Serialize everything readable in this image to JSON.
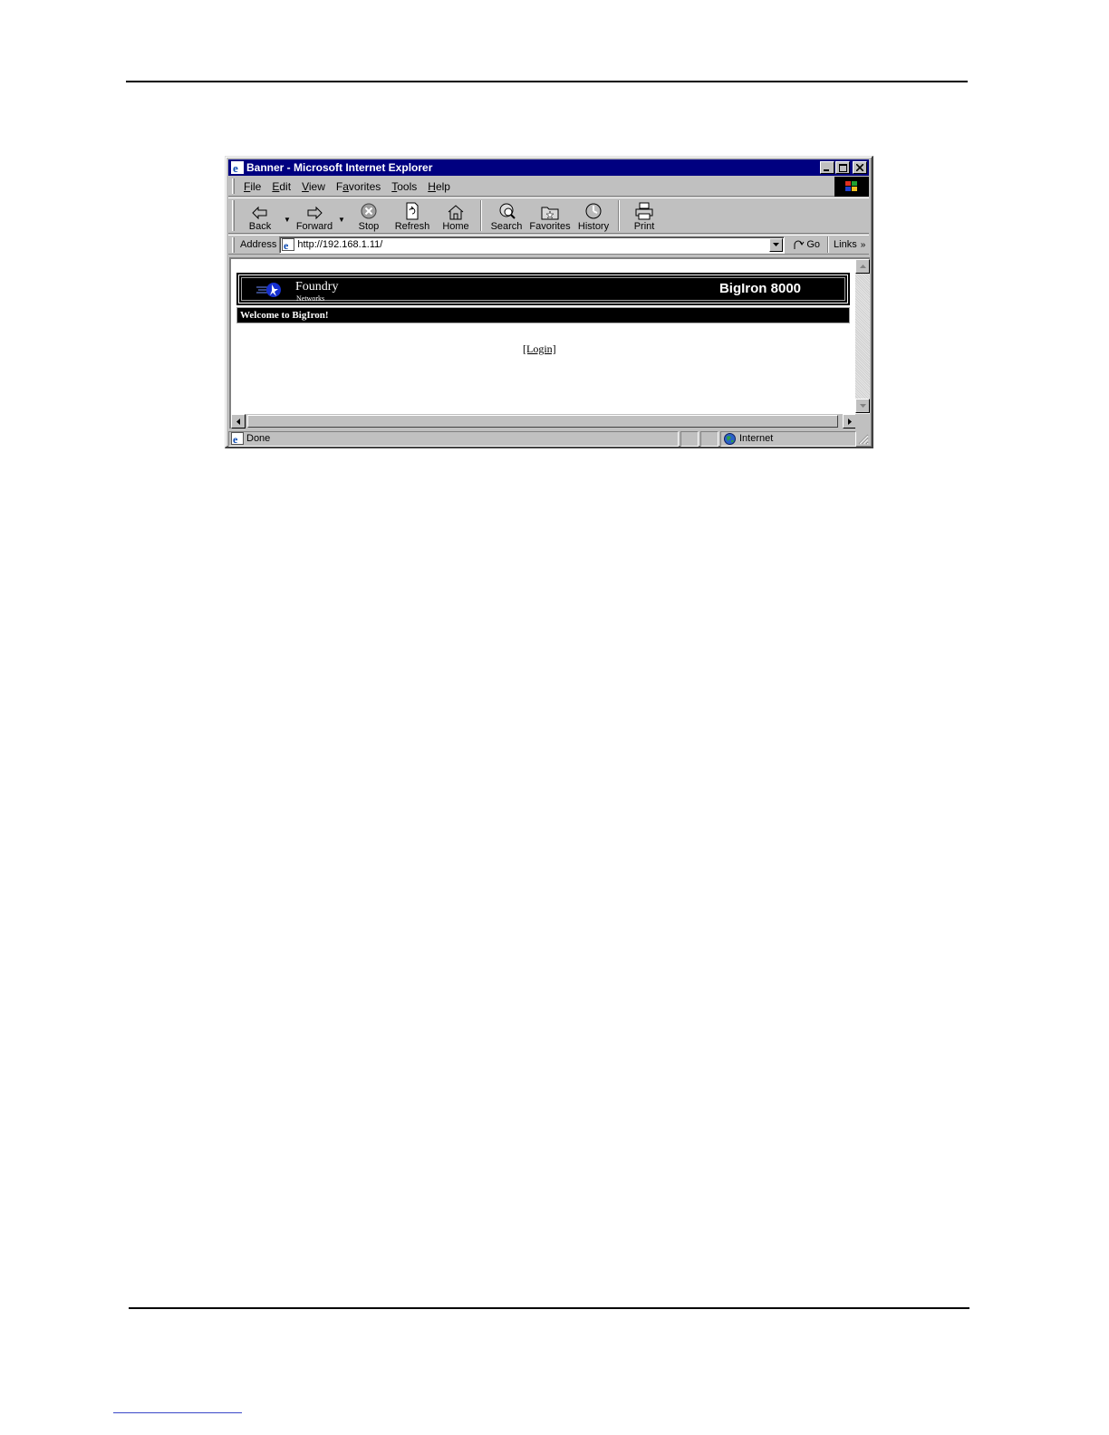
{
  "window": {
    "title": "Banner - Microsoft Internet Explorer"
  },
  "menu": [
    {
      "key": "F",
      "rest": "ile"
    },
    {
      "key": "E",
      "rest": "dit"
    },
    {
      "key": "V",
      "rest": "iew"
    },
    {
      "pre": "F",
      "key": "a",
      "rest": "vorites"
    },
    {
      "key": "T",
      "rest": "ools"
    },
    {
      "key": "H",
      "rest": "elp"
    }
  ],
  "toolbar": {
    "back": "Back",
    "forward": "Forward",
    "stop": "Stop",
    "refresh": "Refresh",
    "home": "Home",
    "search": "Search",
    "favorites": "Favorites",
    "history": "History",
    "print": "Print"
  },
  "address": {
    "label": "Address",
    "url": "http://192.168.1.11/",
    "go": "Go",
    "links": "Links"
  },
  "page": {
    "brand": "Foundry",
    "brand_sub": "Networks",
    "product": "BigIron 8000",
    "welcome": "Welcome to BigIron!",
    "login": "[Login]"
  },
  "status": {
    "text": "Done",
    "zone": "Internet"
  },
  "colors": {
    "titlebar": "#000080",
    "chrome": "#c0c0c0",
    "banner": "#000000"
  }
}
